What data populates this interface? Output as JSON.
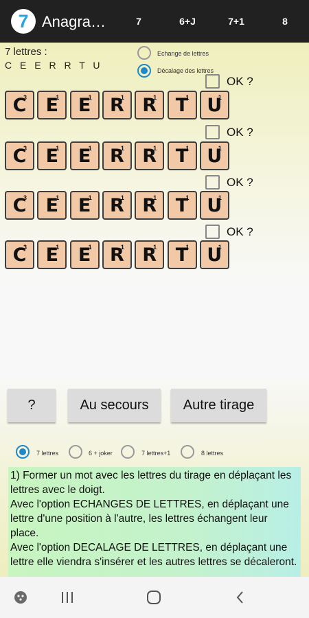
{
  "app": {
    "icon_text": "7",
    "title": "Anagra…",
    "menu": [
      "7",
      "6+J",
      "7+1",
      "8"
    ]
  },
  "draw": {
    "count_label": "7 lettres :",
    "letters_label": "C E E R R T U"
  },
  "options": {
    "swap_label": "Echange de lettres",
    "shift_label": "Décalage des lettres",
    "selected": "shift"
  },
  "tiles": [
    {
      "letter": "C",
      "points": "3"
    },
    {
      "letter": "E",
      "points": "1"
    },
    {
      "letter": "E",
      "points": "1"
    },
    {
      "letter": "R",
      "points": "1"
    },
    {
      "letter": "R",
      "points": "1"
    },
    {
      "letter": "T",
      "points": "1"
    },
    {
      "letter": "U",
      "points": "1"
    }
  ],
  "rows_count": 4,
  "ok_label": "OK ?",
  "buttons": {
    "hint": "?",
    "help": "Au secours",
    "new_draw": "Autre tirage"
  },
  "modes": {
    "items": [
      "7 lettres",
      "6 + joker",
      "7 lettres+1",
      "8 lettres"
    ],
    "selected_index": 0
  },
  "help_text": [
    "1) Former un mot avec les lettres du tirage en déplaçant les lettres avec le doigt.",
    " Avec l'option ECHANGES DE LETTRES, en déplaçant une lettre d'une position à l'autre, les lettres échangent leur place.",
    " Avec l'option DECALAGE DE LETTRES, en déplaçant une lettre elle viendra s'insérer et les autres lettres se décaleront."
  ],
  "navbar": {
    "icons": [
      "game-icon",
      "recents-icon",
      "home-icon",
      "back-icon"
    ]
  }
}
